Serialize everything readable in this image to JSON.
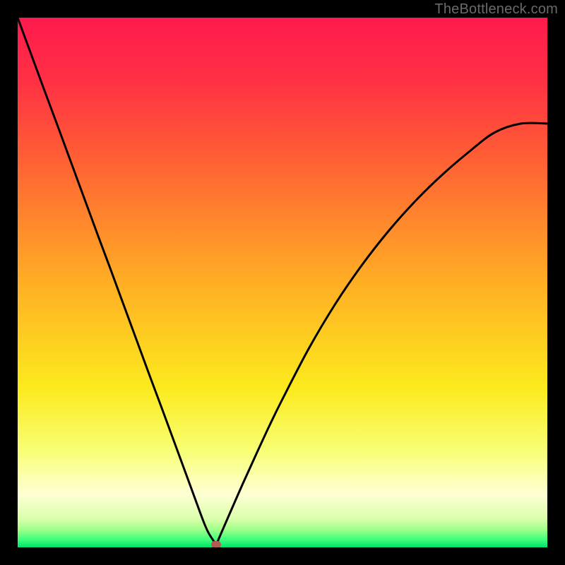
{
  "watermark": "TheBottleneck.com",
  "marker_color": "#b45a55",
  "curve_color": "#000000",
  "curve_width": 3,
  "gradient_stops": [
    {
      "offset": 0.0,
      "color": "#ff1a4e"
    },
    {
      "offset": 0.12,
      "color": "#ff3145"
    },
    {
      "offset": 0.25,
      "color": "#ff5a36"
    },
    {
      "offset": 0.5,
      "color": "#ffae24"
    },
    {
      "offset": 0.7,
      "color": "#fcea1e"
    },
    {
      "offset": 0.82,
      "color": "#f8ff77"
    },
    {
      "offset": 0.9,
      "color": "#feffd4"
    },
    {
      "offset": 0.945,
      "color": "#dcffad"
    },
    {
      "offset": 0.965,
      "color": "#a6ff8d"
    },
    {
      "offset": 0.985,
      "color": "#3fff7a"
    },
    {
      "offset": 1.0,
      "color": "#00e36b"
    }
  ],
  "chart_data": {
    "type": "line",
    "title": "",
    "xlabel": "",
    "ylabel": "",
    "xlim": [
      0,
      100
    ],
    "ylim": [
      0,
      100
    ],
    "legend": false,
    "grid": false,
    "series": [
      {
        "name": "bottleneck-curve",
        "x": [
          0,
          2.5,
          5,
          7.5,
          10,
          12.5,
          15,
          17.5,
          20,
          22.5,
          25,
          27.5,
          30,
          32.5,
          35,
          36,
          37,
          37.5,
          38,
          40,
          42.5,
          45,
          47.5,
          50,
          55,
          60,
          65,
          70,
          75,
          80,
          85,
          90,
          95,
          100
        ],
        "y": [
          100,
          93.2,
          86.4,
          79.7,
          72.9,
          66.1,
          59.3,
          52.6,
          45.8,
          39.0,
          32.2,
          25.5,
          18.7,
          11.9,
          5.1,
          2.8,
          1.2,
          0.5,
          1.7,
          6.3,
          12.0,
          17.5,
          22.9,
          28.0,
          37.6,
          46.0,
          53.3,
          59.7,
          65.3,
          70.2,
          74.5,
          78.3,
          80.0,
          80.0
        ]
      }
    ],
    "annotations": [
      {
        "name": "optimal-point",
        "x": 37.5,
        "y": 0.5
      }
    ]
  }
}
